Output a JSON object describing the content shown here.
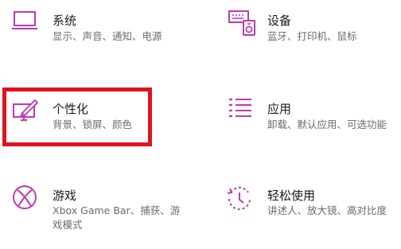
{
  "settings": {
    "tiles": [
      {
        "title": "系统",
        "desc": "显示、声音、通知、电源",
        "icon": "laptop-icon"
      },
      {
        "title": "设备",
        "desc": "蓝牙、打印机、鼠标",
        "icon": "devices-icon"
      },
      {
        "title": "个性化",
        "desc": "背景、锁屏、颜色",
        "icon": "personalization-icon"
      },
      {
        "title": "应用",
        "desc": "卸载、默认应用、可选功能",
        "icon": "apps-list-icon"
      },
      {
        "title": "游戏",
        "desc": "Xbox Game Bar、捕获、游戏模式",
        "icon": "xbox-icon"
      },
      {
        "title": "轻松使用",
        "desc": "讲述人、放大镜、高对比度",
        "icon": "ease-of-access-icon"
      }
    ]
  },
  "accent_color": "#c239b3",
  "highlight_color": "#e0141e"
}
